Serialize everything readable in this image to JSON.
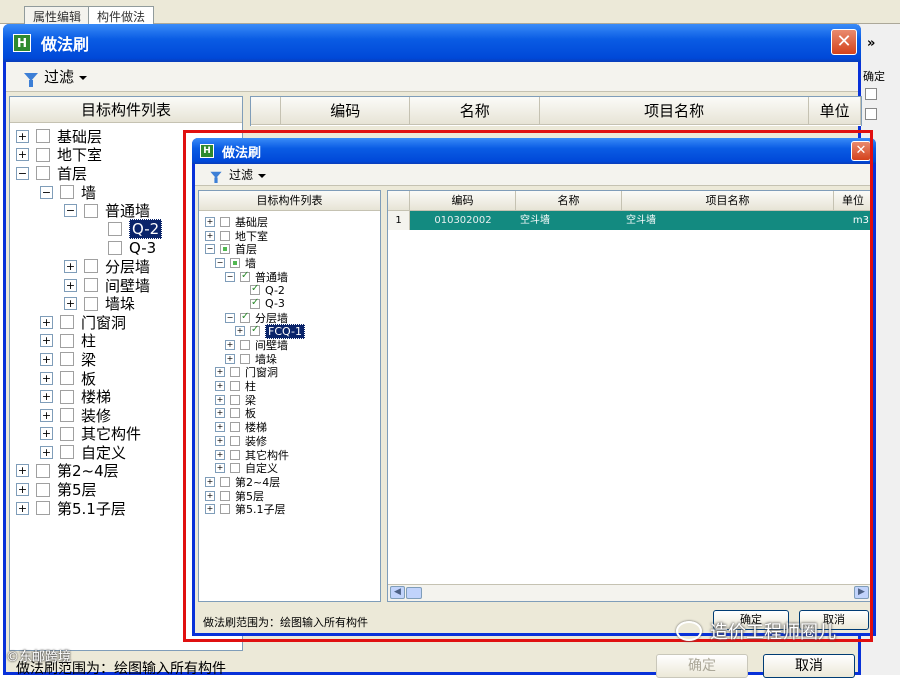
{
  "background_app": {
    "tabs": [
      "属性编辑",
      "构件做法"
    ],
    "side_text_1": "»",
    "side_text_2": "确定"
  },
  "outer_dialog": {
    "title": "做法刷",
    "filter_label": "过滤",
    "list_header": "目标构件列表",
    "grid_columns": [
      "编码",
      "名称",
      "项目名称",
      "单位"
    ],
    "tree": [
      {
        "label": "基础层",
        "level": 0,
        "expander": "+"
      },
      {
        "label": "地下室",
        "level": 0,
        "expander": "+"
      },
      {
        "label": "首层",
        "level": 0,
        "expander": "-"
      },
      {
        "label": "墙",
        "level": 1,
        "expander": "-"
      },
      {
        "label": "普通墙",
        "level": 2,
        "expander": "-"
      },
      {
        "label": "Q-2",
        "level": 3,
        "expander": "",
        "selected": true
      },
      {
        "label": "Q-3",
        "level": 3,
        "expander": ""
      },
      {
        "label": "分层墙",
        "level": 2,
        "expander": "+"
      },
      {
        "label": "间壁墙",
        "level": 2,
        "expander": "+"
      },
      {
        "label": "墙垛",
        "level": 2,
        "expander": "+"
      },
      {
        "label": "门窗洞",
        "level": 1,
        "expander": "+"
      },
      {
        "label": "柱",
        "level": 1,
        "expander": "+"
      },
      {
        "label": "梁",
        "level": 1,
        "expander": "+"
      },
      {
        "label": "板",
        "level": 1,
        "expander": "+"
      },
      {
        "label": "楼梯",
        "level": 1,
        "expander": "+"
      },
      {
        "label": "装修",
        "level": 1,
        "expander": "+"
      },
      {
        "label": "其它构件",
        "level": 1,
        "expander": "+"
      },
      {
        "label": "自定义",
        "level": 1,
        "expander": "+"
      },
      {
        "label": "第2~4层",
        "level": 0,
        "expander": "+"
      },
      {
        "label": "第5层",
        "level": 0,
        "expander": "+"
      },
      {
        "label": "第5.1子层",
        "level": 0,
        "expander": "+"
      }
    ],
    "scope_text": "做法刷范围为：绘图输入所有构件",
    "ok_label": "确定",
    "cancel_label": "取消"
  },
  "inner_dialog": {
    "title": "做法刷",
    "filter_label": "过滤",
    "list_header": "目标构件列表",
    "grid_columns": [
      "编码",
      "名称",
      "项目名称",
      "单位"
    ],
    "grid_rows": [
      {
        "num": "1",
        "code": "010302002",
        "name": "空斗墙",
        "item_name": "空斗墙",
        "unit": "m3"
      }
    ],
    "tree": [
      {
        "label": "基础层",
        "level": 0,
        "expander": "+",
        "check": "none"
      },
      {
        "label": "地下室",
        "level": 0,
        "expander": "+",
        "check": "none"
      },
      {
        "label": "首层",
        "level": 0,
        "expander": "-",
        "check": "partial"
      },
      {
        "label": "墙",
        "level": 1,
        "expander": "-",
        "check": "partial"
      },
      {
        "label": "普通墙",
        "level": 2,
        "expander": "-",
        "check": "checked"
      },
      {
        "label": "Q-2",
        "level": 3,
        "expander": "",
        "check": "checked"
      },
      {
        "label": "Q-3",
        "level": 3,
        "expander": "",
        "check": "checked"
      },
      {
        "label": "分层墙",
        "level": 2,
        "expander": "-",
        "check": "checked"
      },
      {
        "label": "FCQ-1",
        "level": 3,
        "expander": "+",
        "check": "checked",
        "selected": true
      },
      {
        "label": "间壁墙",
        "level": 2,
        "expander": "+",
        "check": "none"
      },
      {
        "label": "墙垛",
        "level": 2,
        "expander": "+",
        "check": "none"
      },
      {
        "label": "门窗洞",
        "level": 1,
        "expander": "+",
        "check": "none"
      },
      {
        "label": "柱",
        "level": 1,
        "expander": "+",
        "check": "none"
      },
      {
        "label": "梁",
        "level": 1,
        "expander": "+",
        "check": "none"
      },
      {
        "label": "板",
        "level": 1,
        "expander": "+",
        "check": "none"
      },
      {
        "label": "楼梯",
        "level": 1,
        "expander": "+",
        "check": "none"
      },
      {
        "label": "装修",
        "level": 1,
        "expander": "+",
        "check": "none"
      },
      {
        "label": "其它构件",
        "level": 1,
        "expander": "+",
        "check": "none"
      },
      {
        "label": "自定义",
        "level": 1,
        "expander": "+",
        "check": "none"
      },
      {
        "label": "第2~4层",
        "level": 0,
        "expander": "+",
        "check": "none"
      },
      {
        "label": "第5层",
        "level": 0,
        "expander": "+",
        "check": "none"
      },
      {
        "label": "第5.1子层",
        "level": 0,
        "expander": "+",
        "check": "none"
      }
    ],
    "scope_text": "做法刷范围为：绘图输入所有构件",
    "ok_label": "确定",
    "cancel_label": "取消"
  },
  "watermark": {
    "text": "造价工程师圈儿",
    "icon": "wechat-icon",
    "corner_text": "©东邮跨境"
  },
  "colors": {
    "title_bar": "#0a5ce4",
    "selected_row": "#138a80",
    "highlight_border": "#e01010"
  }
}
